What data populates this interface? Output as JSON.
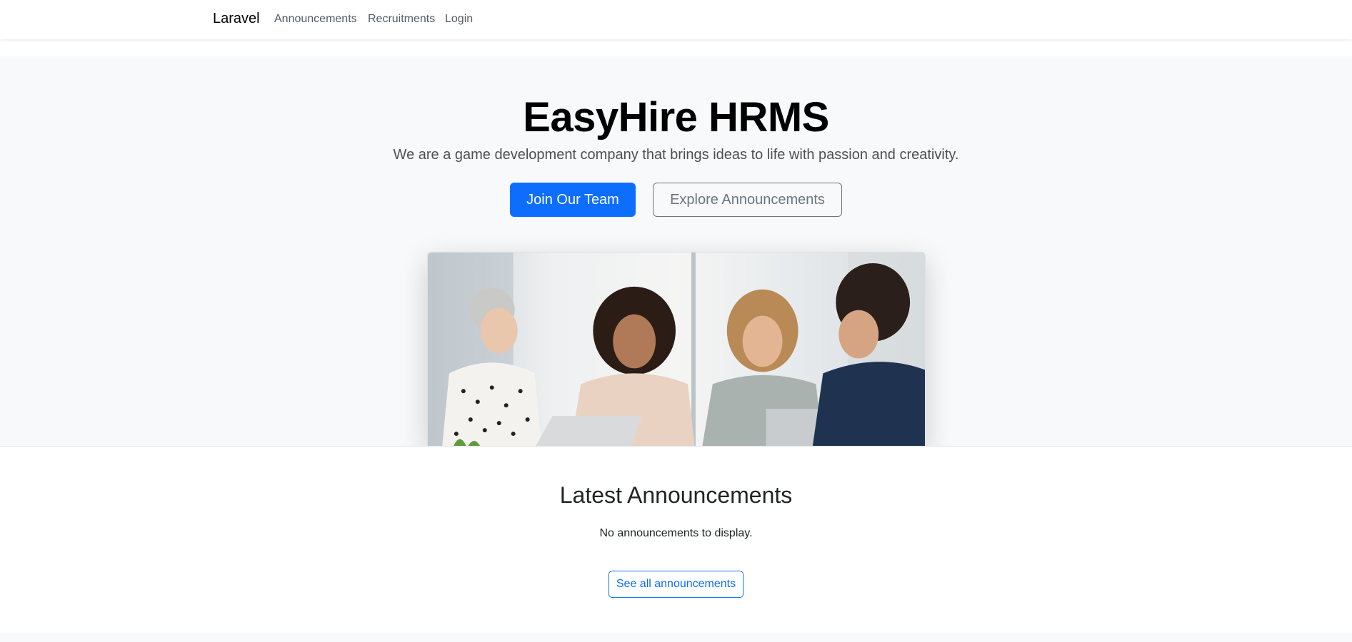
{
  "navbar": {
    "brand": "Laravel",
    "links": [
      "Announcements",
      "Recruitments",
      "Login"
    ]
  },
  "hero": {
    "title": "EasyHire HRMS",
    "lead": "We are a game development company that brings ideas to life with passion and creativity.",
    "primary_button": "Join Our Team",
    "secondary_button": "Explore Announcements"
  },
  "announcements": {
    "title": "Latest Announcements",
    "empty_text": "No announcements to display.",
    "see_all_button": "See all announcements"
  },
  "colors": {
    "primary": "#0d6efd",
    "secondary": "#6c757d",
    "hero_bg": "#f8f9fa"
  }
}
